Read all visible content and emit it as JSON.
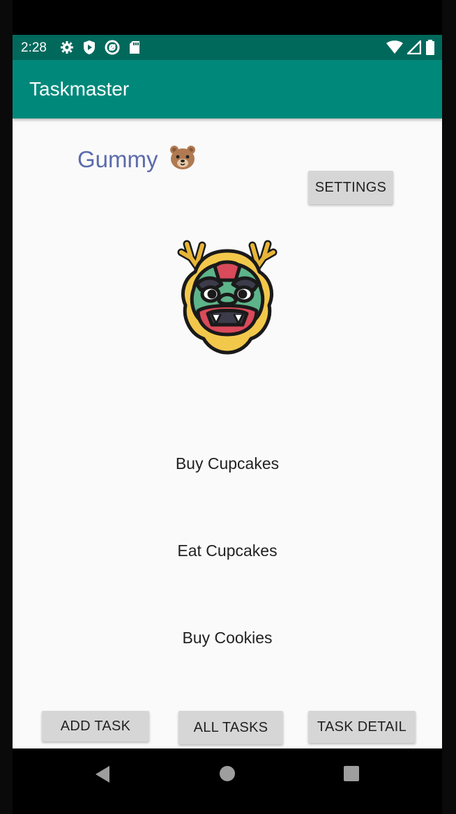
{
  "status_bar": {
    "time": "2:28",
    "left_icons": [
      "gear-icon",
      "shield-play-icon",
      "sync-circle-icon",
      "sd-card-icon"
    ],
    "right_icons": [
      "wifi-icon",
      "signal-icon",
      "battery-icon"
    ],
    "color": "#00695c"
  },
  "app_bar": {
    "title": "Taskmaster",
    "color": "#00897b"
  },
  "main": {
    "greeting": "Gummy",
    "greeting_emoji": "bear-face-icon",
    "settings_label": "SETTINGS",
    "image": "dragon-mask-icon",
    "tasks": [
      {
        "title": "Buy Cupcakes"
      },
      {
        "title": "Eat Cupcakes"
      },
      {
        "title": "Buy Cookies"
      }
    ]
  },
  "bottom_buttons": {
    "add_task": "ADD TASK",
    "all_tasks": "ALL TASKS",
    "task_detail": "TASK DETAIL"
  },
  "nav_bar": {
    "icons": [
      "back-icon",
      "home-icon",
      "recents-icon"
    ]
  }
}
